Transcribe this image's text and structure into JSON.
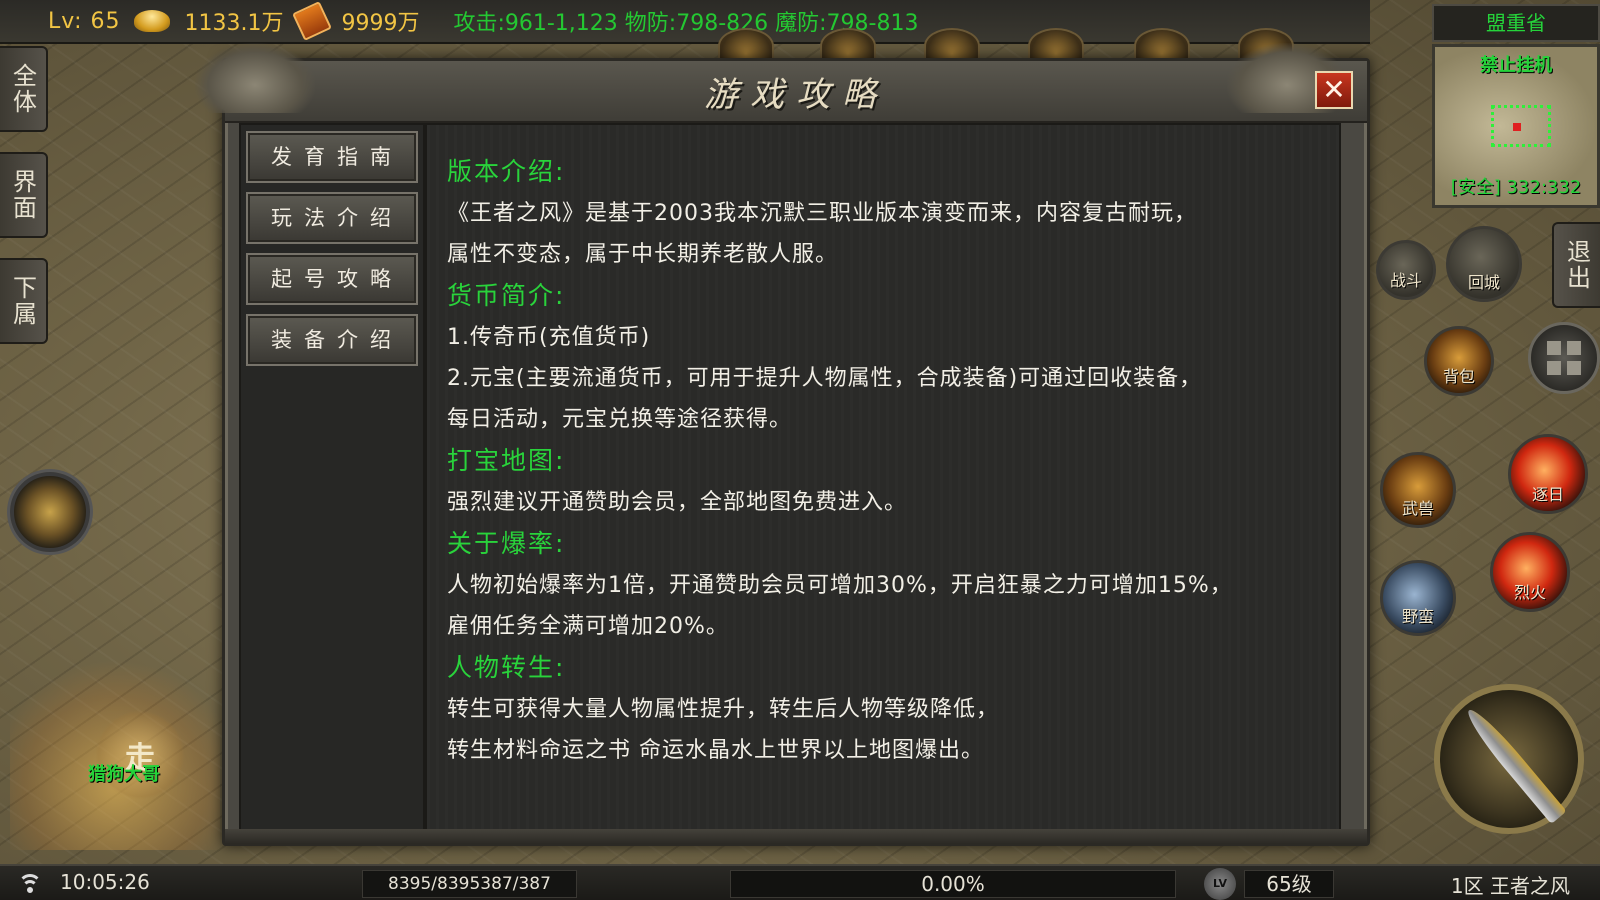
{
  "topbar": {
    "level": "Lv: 65",
    "gold": "1133.1万",
    "currency2": "9999万",
    "stats": "攻击:961-1,123  物防:798-826  魔防:798-813"
  },
  "left_tabs": [
    "全体",
    "界面",
    "下属"
  ],
  "walk": {
    "label": "走",
    "sub": "猎狗大哥"
  },
  "panel": {
    "title": "游戏攻略",
    "close_label": "✕",
    "menu": [
      "发育指南",
      "玩法介绍",
      "起号攻略",
      "装备介绍"
    ],
    "sections": [
      {
        "heading": "版本介绍:",
        "lines": [
          "《王者之风》是基于2003我本沉默三职业版本演变而来，内容复古耐玩，",
          "属性不变态，属于中长期养老散人服。"
        ]
      },
      {
        "heading": "货币简介:",
        "lines": [
          "1.传奇币(充值货币)",
          "2.元宝(主要流通货币，可用于提升人物属性，合成装备)可通过回收装备，",
          "每日活动，元宝兑换等途径获得。"
        ]
      },
      {
        "heading": "打宝地图:",
        "lines": [
          "强烈建议开通赞助会员，全部地图免费进入。"
        ]
      },
      {
        "heading": "关于爆率:",
        "lines": [
          "人物初始爆率为1倍，开通赞助会员可增加30%，开启狂暴之力可增加15%，",
          "雇佣任务全满可增加20%。"
        ]
      },
      {
        "heading": "人物转生:",
        "lines": [
          "转生可获得大量人物属性提升，转生后人物等级降低，",
          "转生材料命运之书 命运水晶水上世界以上地图爆出。"
        ]
      }
    ]
  },
  "right": {
    "region": "盟重省",
    "minimap_warn": "禁止挂机",
    "minimap_coord": "[安全] 332:332",
    "exit_label": "退出",
    "buttons": {
      "battle": "战斗",
      "return_city": "回城",
      "bag": "背包",
      "bull": "武兽",
      "fire": "逐日",
      "savage": "野蛮",
      "blaze": "烈火"
    }
  },
  "bottombar": {
    "time": "10:05:26",
    "hp_mp": "8395/8395387/387",
    "exp": "0.00%",
    "exp_fraction": 0.0,
    "lv_icon": "LV",
    "level": "65级",
    "server": "1区 王者之风"
  },
  "icons": [
    "gold-ingot-icon",
    "scroll-icon",
    "wifi-icon",
    "grid-menu-icon",
    "close-icon"
  ]
}
